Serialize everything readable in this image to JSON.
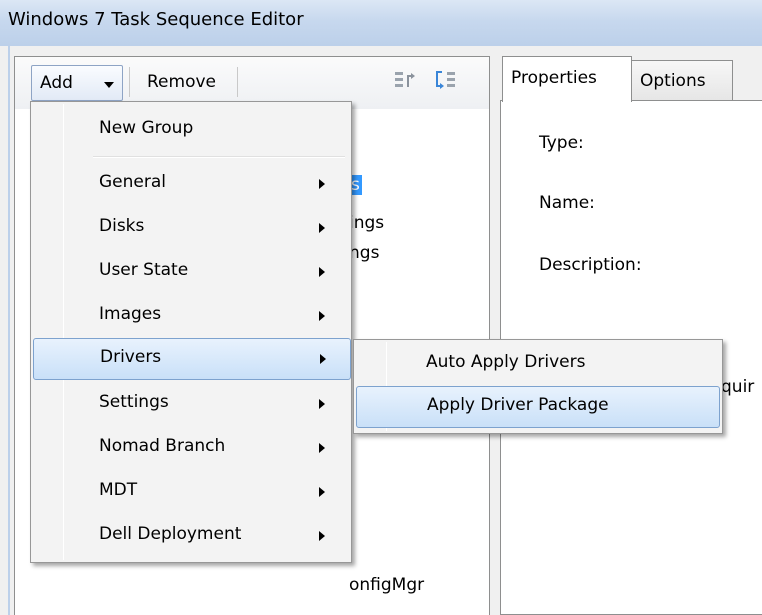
{
  "window": {
    "title": "Windows 7 Task Sequence Editor"
  },
  "toolbar": {
    "add_label": "Add",
    "remove_label": "Remove"
  },
  "tree": {
    "visible_fragments": [
      "s",
      "ings",
      "ngs",
      "onfigMgr"
    ]
  },
  "tabs": [
    {
      "label": "Properties",
      "active": true
    },
    {
      "label": "Options",
      "active": false
    }
  ],
  "properties": {
    "type_label": "Type:",
    "name_label": "Name:",
    "description_label": "Description:",
    "partial_text": "quir"
  },
  "add_menu": {
    "items": [
      {
        "label": "New Group",
        "submenu": false
      },
      {
        "label": "General",
        "submenu": true
      },
      {
        "label": "Disks",
        "submenu": true
      },
      {
        "label": "User State",
        "submenu": true
      },
      {
        "label": "Images",
        "submenu": true
      },
      {
        "label": "Drivers",
        "submenu": true,
        "highlighted": true
      },
      {
        "label": "Settings",
        "submenu": true
      },
      {
        "label": "Nomad Branch",
        "submenu": true
      },
      {
        "label": "MDT",
        "submenu": true
      },
      {
        "label": "Dell Deployment",
        "submenu": true
      }
    ]
  },
  "drivers_submenu": {
    "items": [
      {
        "label": "Auto Apply Drivers"
      },
      {
        "label": "Apply Driver Package",
        "highlighted": true
      }
    ]
  },
  "colors": {
    "highlight_bg": "#c9e0f8",
    "highlight_border": "#7da2ce",
    "selection_blue": "#3399ff"
  }
}
